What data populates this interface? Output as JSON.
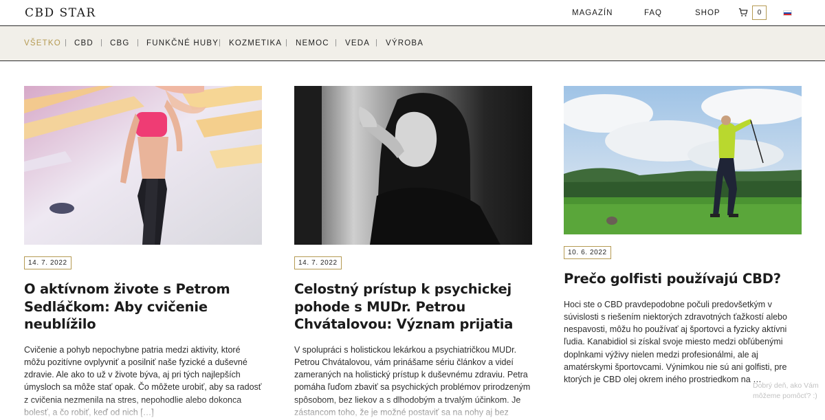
{
  "header": {
    "logo": "CBD STAR",
    "nav": [
      "MAGAZÍN",
      "FAQ",
      "SHOP"
    ],
    "cart_count": "0",
    "cart_icon": "cart-icon",
    "language_flag": "slovak-flag-icon"
  },
  "categories": {
    "items": [
      "VŠETKO",
      "CBD",
      "CBG",
      "FUNKČNÉ HUBY",
      "KOZMETIKA",
      "NEMOC",
      "VEDA",
      "VÝROBA"
    ],
    "active": "VŠETKO",
    "separator": "|",
    "accent_color": "#b59a52"
  },
  "articles": [
    {
      "date": "14. 7. 2022",
      "title": "O aktívnom živote s Petrom Sedláčkom: Aby cvičenie neublížilo",
      "excerpt": "Cvičenie a pohyb nepochybne patria medzi aktivity, ktoré môžu pozitívne ovplyvniť a posilniť naše fyzické a duševné zdravie. Ale ako to už v živote býva, aj pri tých najlepších úmysloch sa môže stať opak. Čo môžete urobiť, aby sa radosť z cvičenia nezmenila na stres, nepohodlie alebo dokonca bolesť, a čo robiť, keď od nich […]"
    },
    {
      "date": "14. 7. 2022",
      "title": "Celostný prístup k psychickej pohode s MUDr. Petrou Chvátalovou: Význam prijatia",
      "excerpt": "V spolupráci s holistickou lekárkou a psychiatričkou MUDr. Petrou Chvátalovou, vám prinášame sériu článkov a videí zameraných na holistický prístup k duševnému zdraviu. Petra pomáha ľuďom zbaviť sa psychických problémov prirodzeným spôsobom, bez liekov a s dlhodobým a trvalým účinkom. Je zástancom toho, že je možné postaviť sa na nohy aj bez liekov. V najnovšej […]"
    },
    {
      "date": "10. 6. 2022",
      "title": "Prečo golfisti používajú CBD?",
      "excerpt": "Hoci ste o CBD pravdepodobne počuli predovšetkým v súvislosti s riešením niektorých zdravotných ťažkostí alebo nespavosti, môžu ho používať aj športovci a fyzicky aktívni ľudia. Kanabidiol si získal svoje miesto medzi obľúbenými doplnkami výživy nielen medzi profesionálmi, ale aj amatérskymi športovcami. Výnimkou nie sú ani golfisti, pre ktorých je CBD olej okrem iného prostriedkom na …"
    }
  ],
  "chat_hint": "Dobrý deň, ako Vám môžeme pomôcť? :)"
}
